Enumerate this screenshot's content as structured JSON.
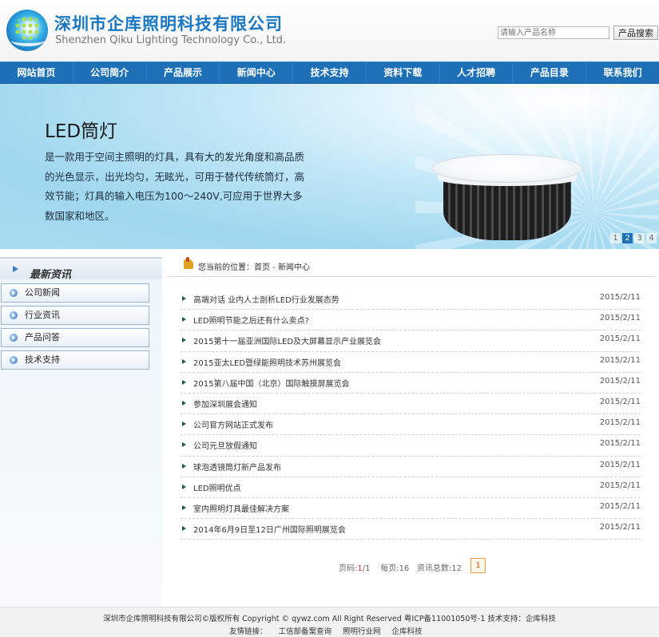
{
  "header": {
    "company_cn": "深圳市企库照明科技有限公司",
    "company_en": "Shenzhen Qiku Lighting Technology Co., Ltd.",
    "search_placeholder": "请输入产品名称",
    "search_button": "产品搜索",
    "logo_icon": "company-logo-icon"
  },
  "nav": {
    "items": [
      "网站首页",
      "公司简介",
      "产品展示",
      "新闻中心",
      "技术支持",
      "资料下载",
      "人才招聘",
      "产品目录",
      "联系我们"
    ]
  },
  "banner": {
    "title": "LED筒灯",
    "description": "是一款用于空间主照明的灯具，具有大的发光角度和高品质的光色显示，出光均匀，无眩光，可用于替代传统筒灯，高效节能；灯具的输入电压为100～240V,可应用于世界大多数国家和地区。",
    "pager": [
      "1",
      "2",
      "3",
      "4"
    ],
    "active_page": "2"
  },
  "sidebar": {
    "title": "最新资讯",
    "items": [
      "公司新闻",
      "行业资讯",
      "产品问答",
      "技术支持"
    ]
  },
  "breadcrumb": {
    "text": "您当前的位置：首页 - 新闻中心"
  },
  "news": [
    {
      "title": "高端对话  业内人士剖析LED行业发展态势",
      "date": "2015/2/11"
    },
    {
      "title": "LED照明节能之后还有什么卖点?",
      "date": "2015/2/11"
    },
    {
      "title": "2015第十一届亚洲国际LED及大屏幕显示产业展览会",
      "date": "2015/2/11"
    },
    {
      "title": "2015亚太LED暨绿能照明技术苏州展览会",
      "date": "2015/2/11"
    },
    {
      "title": "2015第八届中国（北京）国际触摸屏展览会",
      "date": "2015/2/11"
    },
    {
      "title": "参加深圳展会通知",
      "date": "2015/2/11"
    },
    {
      "title": "公司官方网站正式发布",
      "date": "2015/2/11"
    },
    {
      "title": "公司元旦放假通知",
      "date": "2015/2/11"
    },
    {
      "title": "球泡透镜筒灯新产品发布",
      "date": "2015/2/11"
    },
    {
      "title": "LED照明优点",
      "date": "2015/2/11"
    },
    {
      "title": "室内照明灯具最佳解决方案",
      "date": "2015/2/11"
    },
    {
      "title": "2014年6月9日至12日广州国际照明展览会",
      "date": "2015/2/11"
    }
  ],
  "pagination": {
    "label_page": "页码:",
    "current": "1",
    "total_pages": "/1",
    "per_page": "每页:16",
    "total": "资讯总数:12",
    "button": "1"
  },
  "footer": {
    "line1": "深圳市企库照明科技有限公司©版权所有 Copyright © qywz.com All Right Reserved  粤ICP备11001050号-1  技术支持：企库科技",
    "links_label": "友情链接：",
    "links": [
      "工信部备案查询",
      "照明行业网",
      "企库科技"
    ]
  }
}
